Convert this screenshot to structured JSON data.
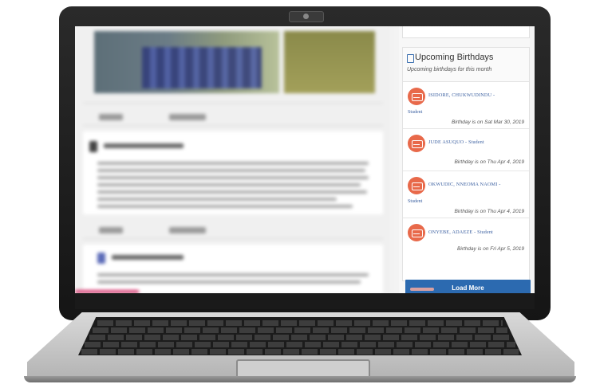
{
  "birthdays": {
    "title": "Upcoming Birthdays",
    "subtitle": "Upcoming birthdays for this month",
    "items": [
      {
        "name": "ISIDORE, CHUKWUDINDU",
        "role": "Student",
        "date": "Birthday is on Sat Mar 30, 2019"
      },
      {
        "name": "JUDE ASUQUO",
        "role": "Student",
        "date": "Birthday is on Thu Apr 4, 2019"
      },
      {
        "name": "OKWUDIC, NNEOMA NAOMI",
        "role": "Student",
        "date": "Birthday is on Thu Apr 4, 2019"
      },
      {
        "name": "ONYEBE, ADAEZE",
        "role": "Student",
        "date": "Birthday is on Fri Apr 5, 2019"
      }
    ],
    "load_more_label": "Load More"
  },
  "colors": {
    "accent": "#2c6ab0",
    "avatar": "#e8694a",
    "progress": "#d6336c"
  },
  "icons": {
    "card_header": "calendar-icon",
    "birthday_avatar": "birthday-cake-icon"
  }
}
